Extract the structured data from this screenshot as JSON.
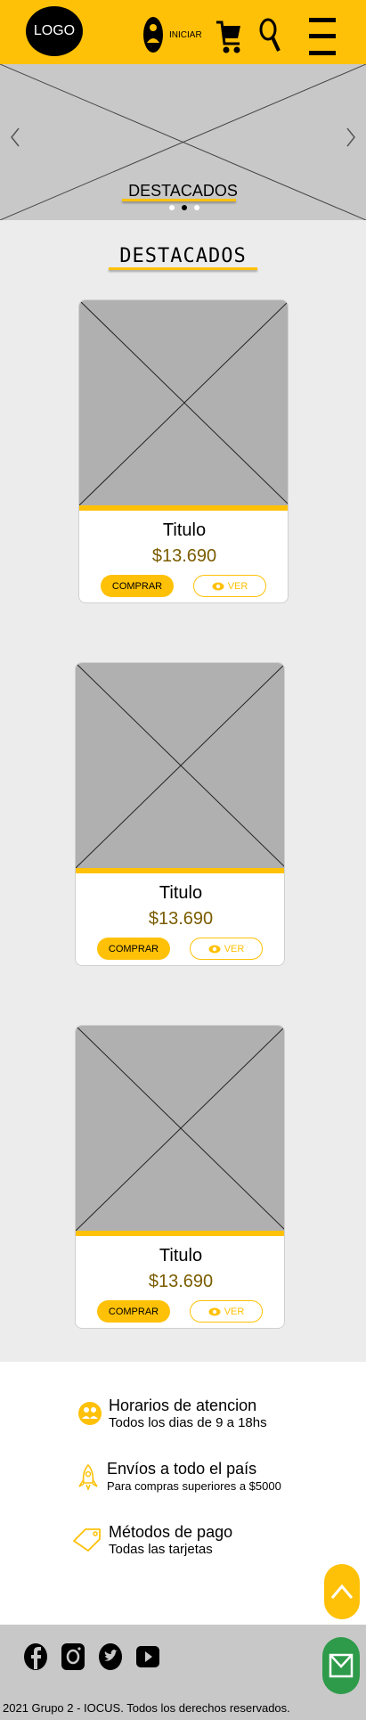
{
  "header": {
    "logo_label": "LOGO",
    "login_label": "INICIAR",
    "icons": [
      "user-icon",
      "cart-icon",
      "search-icon",
      "menu-icon"
    ]
  },
  "hero": {
    "title": "DESTACADOS",
    "slides_count": 3,
    "active_slide": 2
  },
  "section": {
    "title": "DESTACADOS"
  },
  "products": [
    {
      "title": "Titulo",
      "price": "$13.690",
      "buy_label": "COMPRAR",
      "view_label": "VER"
    },
    {
      "title": "Titulo",
      "price": "$13.690",
      "buy_label": "COMPRAR",
      "view_label": "VER"
    },
    {
      "title": "Titulo",
      "price": "$13.690",
      "buy_label": "COMPRAR",
      "view_label": "VER"
    }
  ],
  "info": [
    {
      "icon": "clock-people-icon",
      "title": "Horarios de atencion",
      "subtitle": "Todos los dias de 9 a 18hs"
    },
    {
      "icon": "rocket-icon",
      "title": "Envíos a todo el país",
      "subtitle": "Para compras superiores a $5000"
    },
    {
      "icon": "tag-icon",
      "title": "Métodos de pago",
      "subtitle": "Todas las tarjetas"
    }
  ],
  "footer": {
    "social": [
      "facebook-icon",
      "instagram-icon",
      "twitter-icon",
      "youtube-icon"
    ],
    "copyright": "2021 Grupo 2 - IOCUS. Todos los derechos reservados."
  },
  "colors": {
    "accent": "#ffc107",
    "price": "#7a5c00",
    "mail_button": "#2e9b4a",
    "placeholder": "#b0b0b0"
  }
}
